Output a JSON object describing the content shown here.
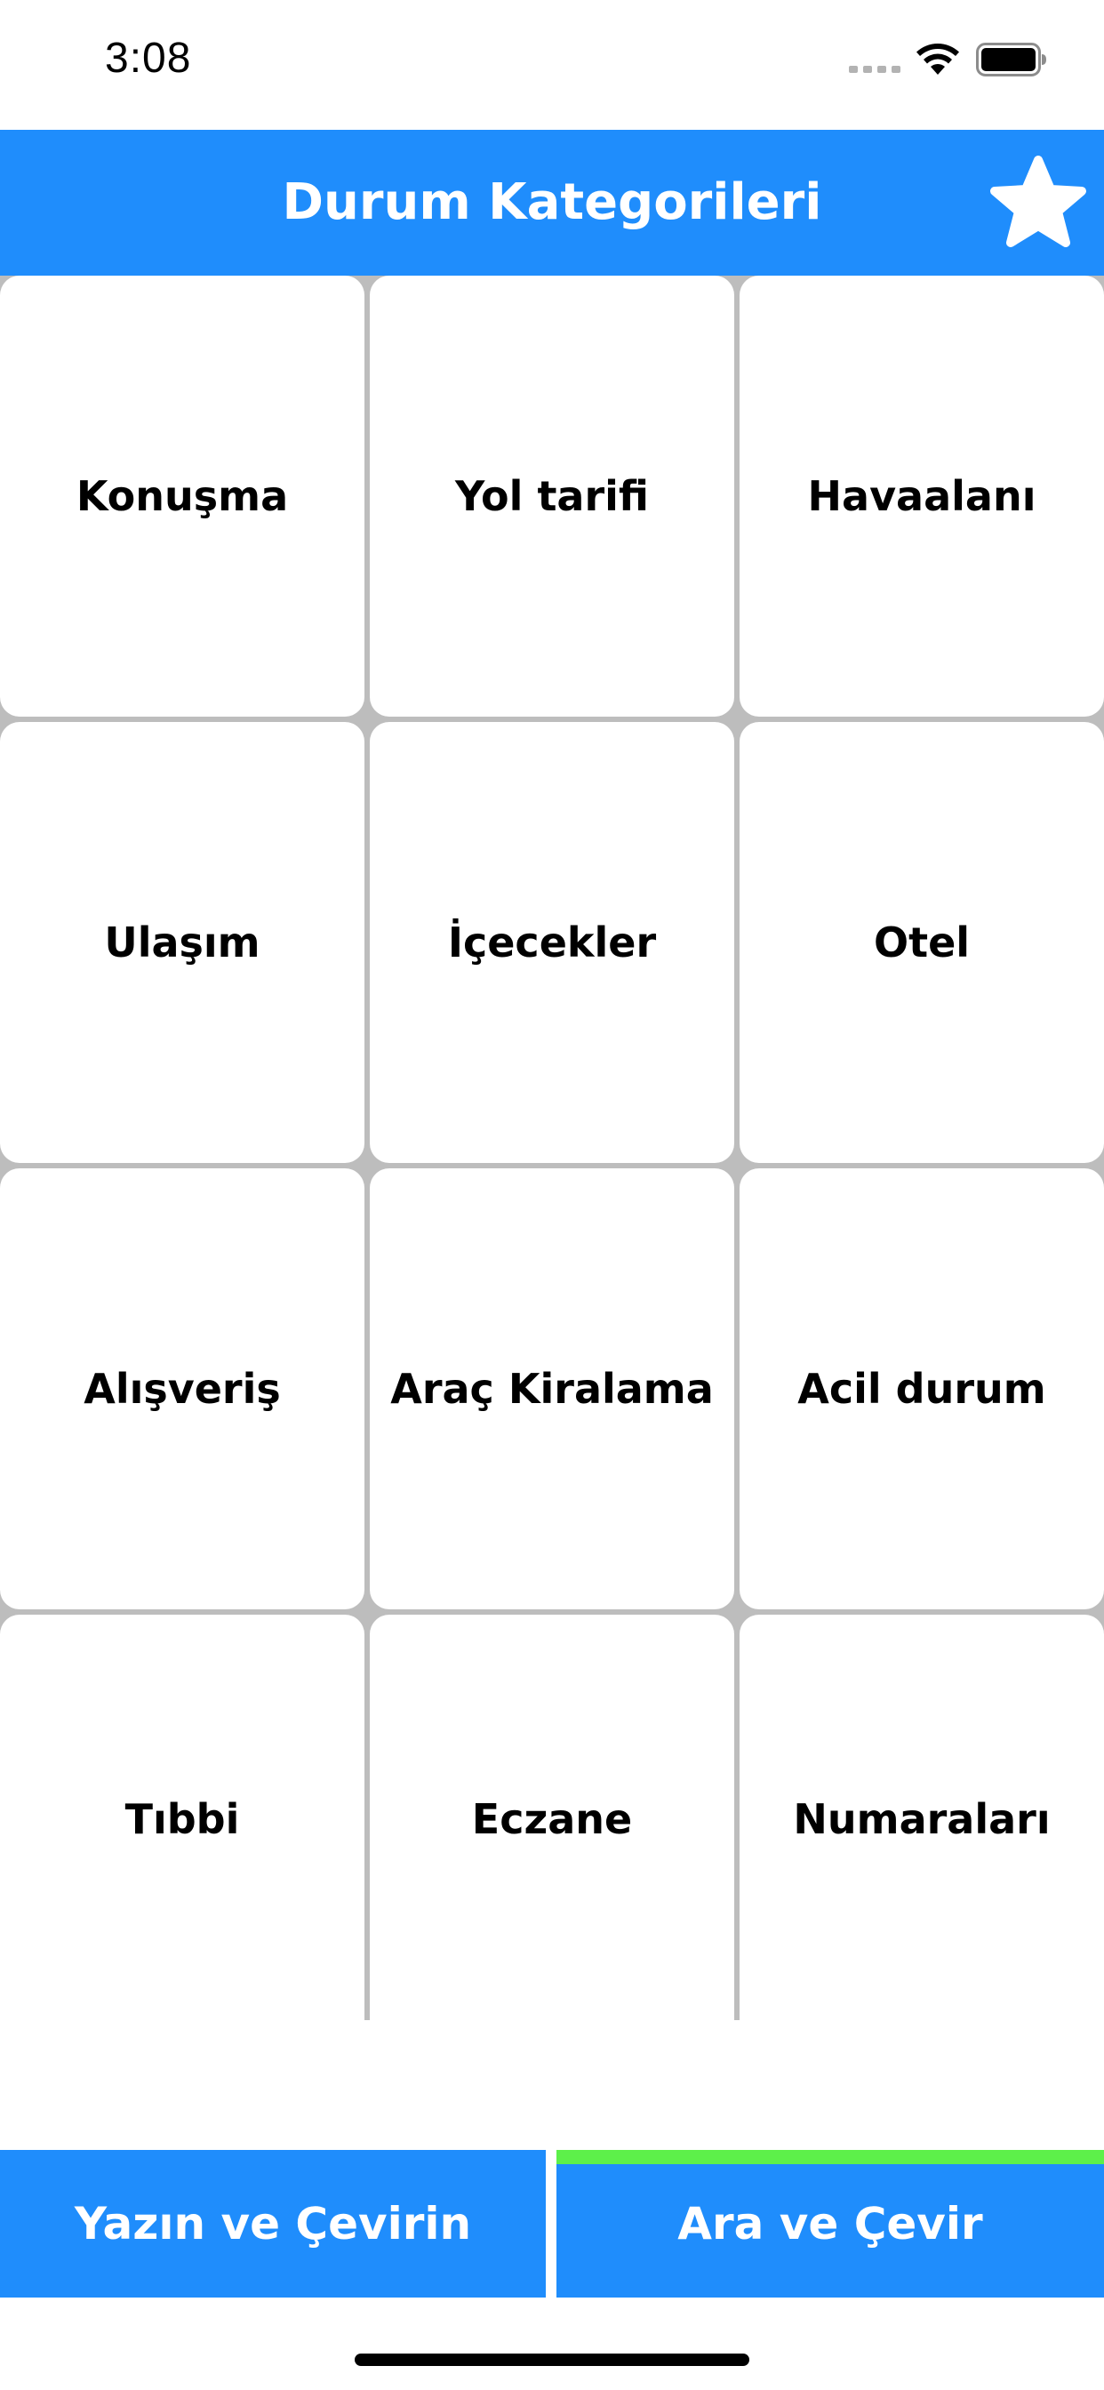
{
  "status_bar": {
    "time": "3:08",
    "icons": [
      "cellular-signal-icon",
      "wifi-icon",
      "battery-icon"
    ]
  },
  "header": {
    "title": "Durum Kategorileri",
    "favorites_icon": "star-icon"
  },
  "categories": [
    "Konuşma",
    "Yol tarifi",
    "Havaalanı",
    "Ulaşım",
    "İçecekler",
    "Otel",
    "Alışveriş",
    "Araç Kiralama",
    "Acil durum",
    "Tıbbi",
    "Eczane",
    "Numaraları"
  ],
  "tabs": [
    {
      "label": "Yazın ve Çevirin",
      "active": false
    },
    {
      "label": "Ara ve Çevir",
      "active": true
    }
  ],
  "colors": {
    "primary": "#1f8dfc",
    "active_indicator": "#5df04a",
    "grid_background": "#bdbdbd",
    "tile": "#ffffff"
  }
}
